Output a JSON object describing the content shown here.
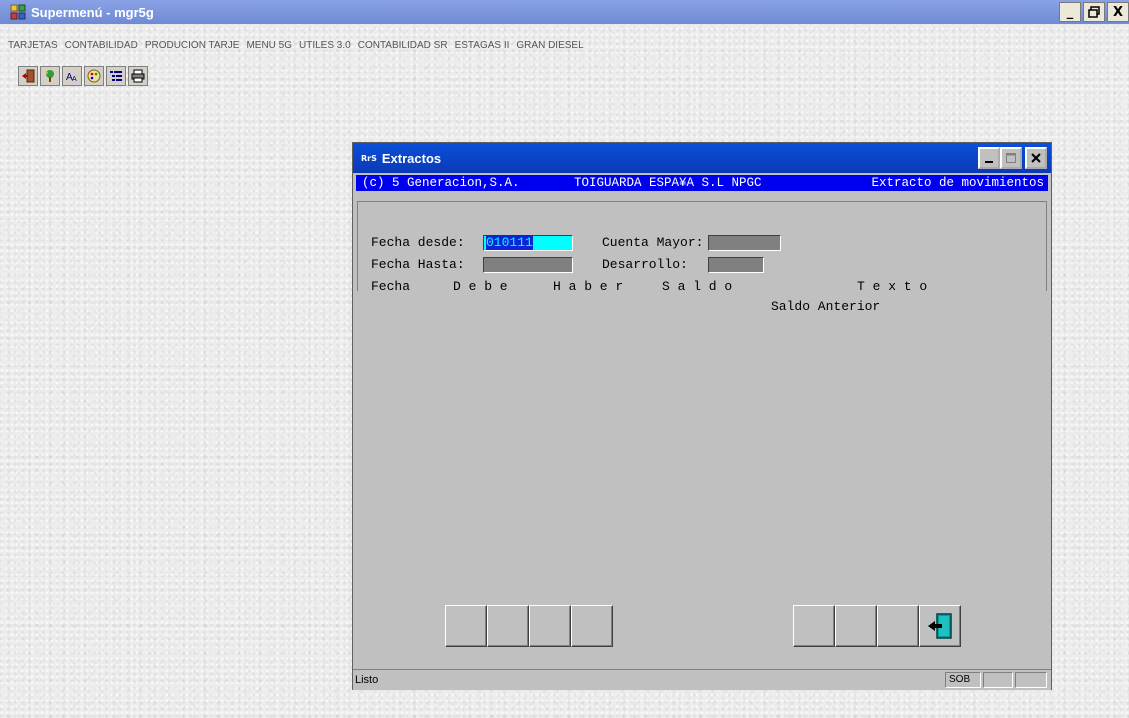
{
  "app": {
    "title": "Supermenú - mgr5g",
    "window_controls": [
      "_",
      "🗗",
      "X"
    ]
  },
  "menu": {
    "items": [
      "TARJETAS",
      "CONTABILIDAD",
      "PRODUCION TARJE",
      "MENU 5G",
      "UTILES 3.0",
      "CONTABILIDAD SR",
      "ESTAGAS II",
      "GRAN DIESEL"
    ]
  },
  "toolbar": {
    "icons": [
      "exit-door-icon",
      "tree-icon",
      "font-size-icon",
      "palette-icon",
      "list-tree-icon",
      "printer-icon"
    ]
  },
  "child": {
    "title": "Extractos",
    "logo": "RrS",
    "controls": [
      "_",
      "□",
      "X"
    ],
    "info": {
      "copyright": "(c) 5 Generacion,S.A.",
      "company": "TOIGUARDA ESPA¥A S.L NPGC",
      "module": "Extracto de movimientos"
    },
    "form": {
      "fecha_desde_label": "Fecha desde:",
      "fecha_desde_value": "010111",
      "fecha_hasta_label": "Fecha Hasta:",
      "fecha_hasta_value": "",
      "cuenta_mayor_label": "Cuenta Mayor:",
      "cuenta_mayor_value": "",
      "desarrollo_label": "Desarrollo:",
      "desarrollo_value": ""
    },
    "columns": {
      "fecha": "Fecha",
      "debe": "D e b e",
      "haber": "H a b e r",
      "saldo": "S a l d o",
      "texto": "T e x t o"
    },
    "saldo_anterior": "Saldo Anterior",
    "status": {
      "text": "Listo",
      "panel1": "SOB",
      "panel2": "",
      "panel3": ""
    }
  }
}
